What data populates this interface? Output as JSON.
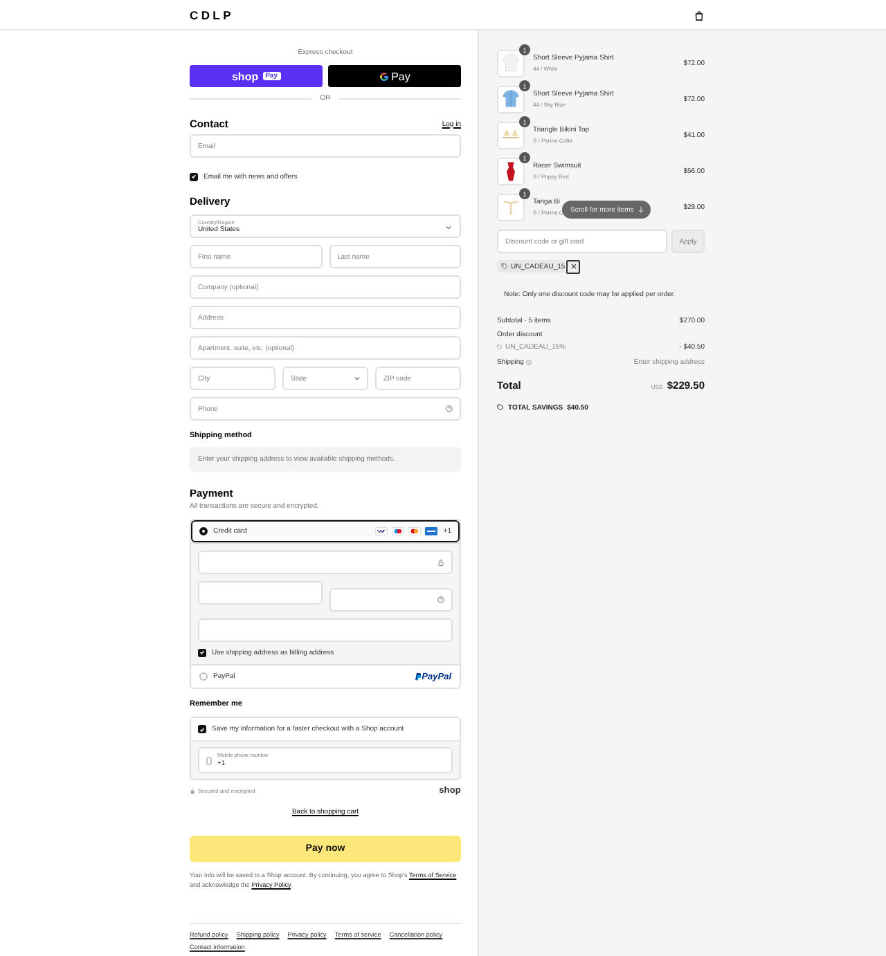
{
  "header": {
    "logo": "CDLP"
  },
  "express_checkout": {
    "title": "Express checkout",
    "buttons": [
      {
        "kind": "shop",
        "label": "shop",
        "badge": "Pay"
      },
      {
        "kind": "gpay",
        "label": "Pay"
      }
    ],
    "divider": "OR"
  },
  "contact": {
    "title": "Contact",
    "login": "Log in",
    "email": {
      "placeholder": "Email"
    },
    "newsletter": {
      "label": "Email me with news and offers",
      "checked": true
    }
  },
  "delivery": {
    "title": "Delivery",
    "country": {
      "label": "Country/Region",
      "value": "United States"
    },
    "rows": [
      [
        {
          "kind": "text",
          "placeholder": "First name"
        },
        {
          "kind": "text",
          "placeholder": "Last name"
        }
      ],
      [
        {
          "kind": "text",
          "placeholder": "Company (optional)"
        }
      ],
      [
        {
          "kind": "text",
          "placeholder": "Address"
        }
      ],
      [
        {
          "kind": "text",
          "placeholder": "Apartment, suite, etc. (optional)"
        }
      ],
      [
        {
          "kind": "text",
          "placeholder": "City"
        },
        {
          "kind": "select",
          "label": "State"
        },
        {
          "kind": "text",
          "placeholder": "ZIP code"
        }
      ],
      [
        {
          "kind": "help",
          "placeholder": "Phone"
        }
      ]
    ]
  },
  "shipping_method": {
    "title": "Shipping method",
    "message": "Enter your shipping address to view available shipping methods."
  },
  "payment": {
    "title": "Payment",
    "subtitle": "All transactions are secure and encrypted.",
    "methods": [
      {
        "kind": "card",
        "label": "Credit card",
        "selected": true,
        "more_cards": "+1",
        "billing": {
          "label": "Use shipping address as billing address",
          "checked": true
        }
      },
      {
        "kind": "paypal",
        "label": "PayPal",
        "logo": "PayPal",
        "selected": false
      }
    ]
  },
  "remember_me": {
    "title": "Remember me",
    "save": {
      "label": "Save my information for a faster checkout with a Shop account",
      "checked": true
    },
    "phone": {
      "label": "Mobile phone number",
      "value": "+1"
    },
    "secure": "Secured and encrypted",
    "shop_logo": "shop"
  },
  "back_link": "Back to shopping cart",
  "pay_button": "Pay now",
  "legal": [
    {
      "text": "Your info will be saved to a Shop account. By continuing, you agree to Shop's ",
      "link": false
    },
    {
      "text": "Terms of Service",
      "link": true
    },
    {
      "text": " and acknowledge the ",
      "link": false
    },
    {
      "text": "Privacy Policy",
      "link": true
    },
    {
      "text": ".",
      "link": false
    }
  ],
  "footer_links": [
    "Refund policy",
    "Shipping policy",
    "Privacy policy",
    "Terms of service",
    "Cancellation policy",
    "Contact information"
  ],
  "summary": {
    "items": [
      {
        "name": "Short Sleeve Pyjama Shirt",
        "variant": "44 / White",
        "quantity": "1",
        "price": "$72.00"
      },
      {
        "name": "Short Sleeve Pyjama Shirt",
        "variant": "44 / Sky Blue",
        "quantity": "1",
        "price": "$72.00"
      },
      {
        "name": "Triangle Bikini Top",
        "variant": "S / Parma Cotta",
        "quantity": "1",
        "price": "$41.00"
      },
      {
        "name": "Racer Swimsuit",
        "variant": "S / Poppy Red",
        "quantity": "1",
        "price": "$56.00"
      },
      {
        "name": "Tanga Bi",
        "variant": "S / Parma C",
        "quantity": "1",
        "price": "$29.00"
      }
    ],
    "scroll_hint": "Scroll for more items",
    "discount": {
      "placeholder": "Discount code or gift card",
      "apply": "Apply"
    },
    "applied_code": "UN_CADEAU_15",
    "note": "Note: Only one discount code may be applied per order.",
    "subtotal": {
      "label": "Subtotal · 5 items",
      "value": "$270.00"
    },
    "order_discount": {
      "label": "Order discount",
      "code": "UN_CADEAU_15%",
      "value": "- $40.50"
    },
    "shipping": {
      "label": "Shipping",
      "value": "Enter shipping address"
    },
    "total": {
      "label": "Total",
      "currency": "USD",
      "value": "$229.50"
    },
    "savings": {
      "label": "TOTAL SAVINGS",
      "value": "$40.50"
    }
  }
}
